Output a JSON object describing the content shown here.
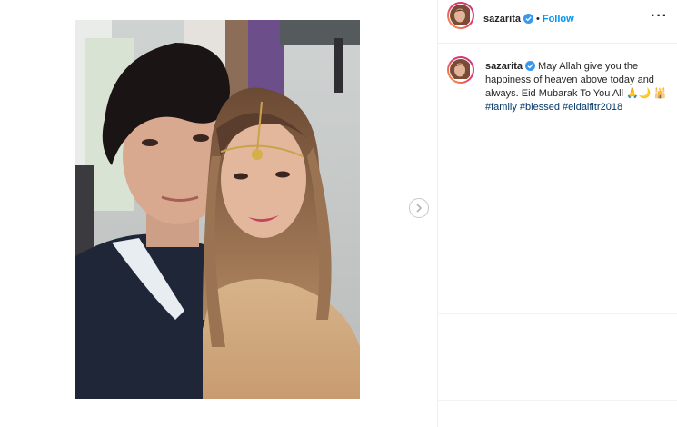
{
  "post": {
    "username": "sazarita",
    "follow_label": "Follow",
    "separator": "•",
    "more_icon": "more-options-icon",
    "caption_text": "May Allah give you the happiness of heaven above today and always. Eid Mubarak To You All 🙏🌙 🕌",
    "hashtags": [
      "#family",
      "#blessed",
      "#eidalfitr2018"
    ]
  },
  "colors": {
    "accent": "#0095f6",
    "hashtag": "#00376b",
    "verified": "#3897f0"
  }
}
